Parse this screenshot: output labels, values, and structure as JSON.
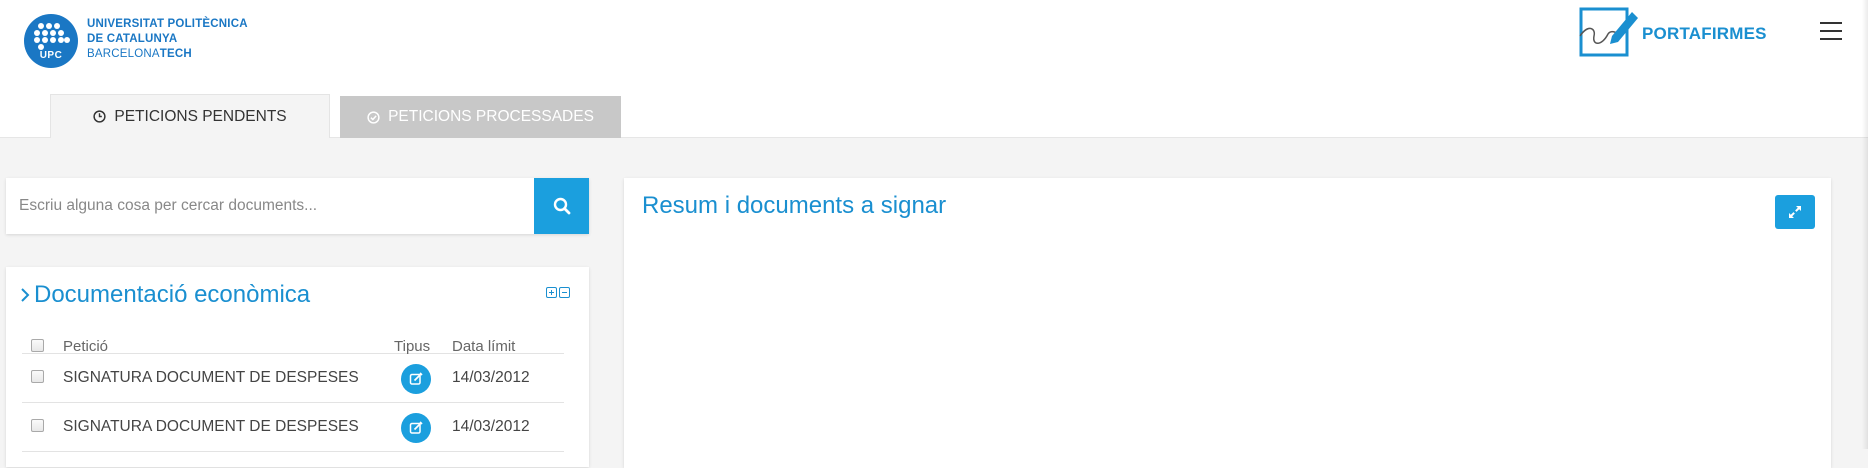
{
  "brand": {
    "logo_badge": "UPC",
    "line1": "UNIVERSITAT POLITÈCNICA",
    "line2": "DE CATALUNYA",
    "line3_light": "BARCELONA",
    "line3_bold": "TECH",
    "primary_color": "#1a77c4"
  },
  "app": {
    "title": "PORTAFIRMES",
    "accent_color": "#1b9fde"
  },
  "tabs": [
    {
      "label": "PETICIONS PENDENTS",
      "icon": "clock-icon",
      "active": true
    },
    {
      "label": "PETICIONS PROCESSADES",
      "icon": "check-circle-icon",
      "active": false
    }
  ],
  "search": {
    "placeholder": "Escriu alguna cosa per cercar documents...",
    "value": ""
  },
  "doc_group": {
    "title": "Documentació econòmica",
    "columns": [
      "Petició",
      "Tipus",
      "Data límit"
    ],
    "rows": [
      {
        "peticio": "SIGNATURA DOCUMENT DE DESPESES",
        "tipus_icon": "edit-icon",
        "data": "14/03/2012"
      },
      {
        "peticio": "SIGNATURA DOCUMENT DE DESPESES",
        "tipus_icon": "edit-icon",
        "data": "14/03/2012"
      }
    ]
  },
  "resum": {
    "title": "Resum i documents a signar"
  }
}
